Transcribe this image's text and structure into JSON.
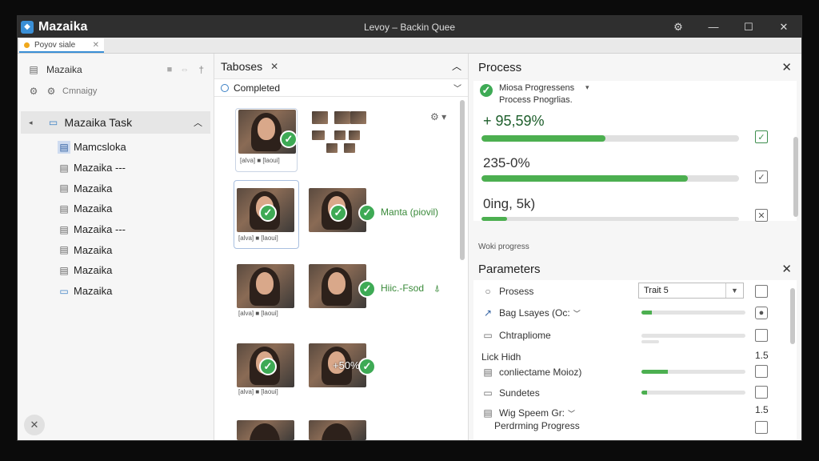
{
  "window": {
    "app_name": "Mazaika",
    "title": "Levoy – Backin Quee",
    "buttons": {
      "settings": "⚙",
      "minimize": "—",
      "maximize": "☐",
      "close": "✕"
    }
  },
  "doc_tab": {
    "label": "Poyov siale",
    "close": "✕"
  },
  "left": {
    "header_label": "Mazaika",
    "sub_label": "Cmnaigy",
    "task_label": "Mazaika Task",
    "items": [
      {
        "label": "Mamcsloka",
        "icon": "file-selected-icon"
      },
      {
        "label": "Mazaika ---",
        "icon": "file-icon"
      },
      {
        "label": "Mazaika",
        "icon": "file-icon"
      },
      {
        "label": "Mazaika",
        "icon": "file-icon"
      },
      {
        "label": "Mazaika ---",
        "icon": "file-icon"
      },
      {
        "label": "Mazaika",
        "icon": "file-icon"
      },
      {
        "label": "Mazaika",
        "icon": "file-icon"
      },
      {
        "label": "Mazaika",
        "icon": "folder-icon"
      }
    ]
  },
  "middle": {
    "tab_label": "Taboses",
    "filter_label": "Completed",
    "labels": {
      "row2_text": "Manta (piovil)",
      "row3_text": "Hiic.-Fsod",
      "row4_badge": "+50%",
      "mini_caption": "[alva] ■ [laoui]"
    }
  },
  "process": {
    "title": "Process",
    "subtitle_main": "Miosa Progressens",
    "subtitle_sub": "Process Pnogrlias.",
    "items": [
      {
        "value": "+ 95,59%",
        "progress": 0.48,
        "checked": true
      },
      {
        "value": "235-0%",
        "progress": 0.8,
        "checked": true
      },
      {
        "value": "0ing, 5k)",
        "progress": 0.1,
        "checked": false
      }
    ],
    "footer_label": "Woki progress"
  },
  "parameters": {
    "title": "Parameters",
    "select_value": "Trait 5",
    "rows": [
      {
        "label": "Prosess",
        "icon": "radio-icon"
      },
      {
        "label": "Bag Lsayes (Oc:",
        "icon": "trend-icon"
      },
      {
        "label": "Chtrapliome",
        "icon": "folder-icon"
      },
      {
        "label": "Lick Hidh",
        "icon": ""
      },
      {
        "label": "conliectame Moioz)",
        "icon": "file-icon"
      },
      {
        "label": "Sundetes",
        "icon": "folder-icon"
      },
      {
        "label": "Wig Speem Gr:",
        "icon": "file-icon"
      },
      {
        "label": "Perdrming Progress",
        "icon": ""
      }
    ],
    "values": {
      "lick": "1.5",
      "wig": "1.5"
    },
    "progress": {
      "row2": 0.1,
      "row5": 0.25,
      "row6": 0.05
    }
  }
}
